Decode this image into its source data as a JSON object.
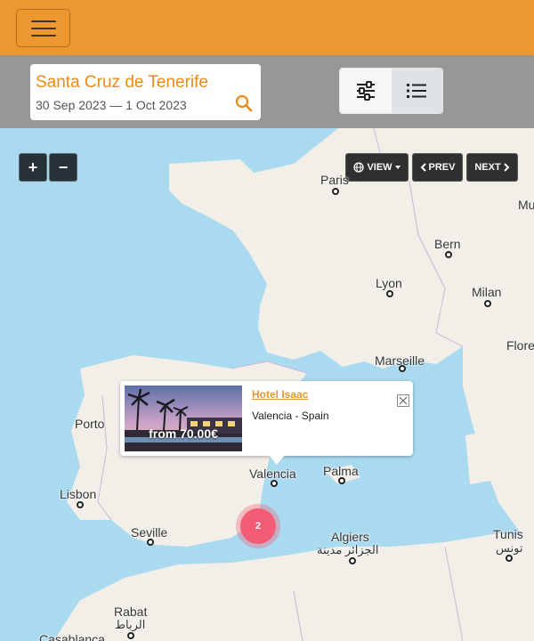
{
  "header": {
    "menu_icon": "hamburger-menu-icon",
    "color": "#ec972f"
  },
  "search": {
    "city": "Santa Cruz de Tenerife",
    "dates": "30 Sep 2023 — 1 Oct 2023",
    "icon": "search-icon",
    "accent": "#ec8a14"
  },
  "view_toggle": {
    "filters_icon": "sliders-icon",
    "list_icon": "list-icon",
    "active": "list"
  },
  "map": {
    "zoom_in": "+",
    "zoom_out": "−",
    "view_label": "VIEW",
    "prev_label": "PREV",
    "next_label": "NEXT",
    "cities": {
      "paris": "Paris",
      "munich": "Mu",
      "bern": "Bern",
      "lyon": "Lyon",
      "milan": "Milan",
      "florence": "Flore",
      "marseille": "Marseille",
      "porto": "Porto",
      "valencia": "Valencia",
      "palma": "Palma",
      "lisbon": "Lisbon",
      "seville": "Seville",
      "algiers": "Algiers",
      "algiers_ar": "الجزائر مدينة",
      "tunis": "Tunis",
      "tunis_ar": "تونس",
      "rabat": "Rabat",
      "rabat_ar": "الرباط",
      "casablanca": "Casablanca"
    },
    "cluster_count": "2",
    "cluster_color": "#f25d75"
  },
  "popup": {
    "hotel_name": "Hotel Isaac",
    "location": "Valencia - Spain",
    "price": "from 70.00€",
    "close_icon": "close-icon"
  }
}
